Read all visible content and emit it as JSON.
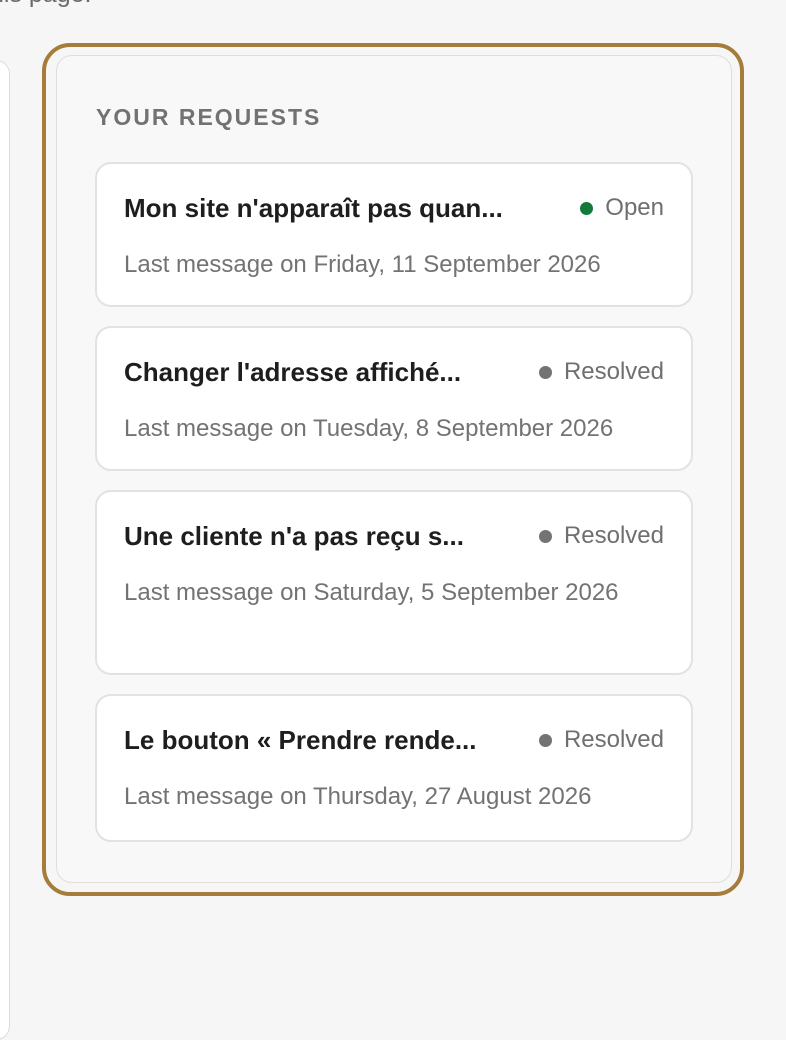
{
  "page": {
    "top_text": "his page."
  },
  "requests": {
    "title": "YOUR REQUESTS",
    "items": [
      {
        "title": "Mon site n'apparaît pas quan...",
        "status": "Open",
        "status_color": "#137a3b",
        "last_message": "Last message on Friday, 11 September 2026"
      },
      {
        "title": "Changer l'adresse affiché...",
        "status": "Resolved",
        "status_color": "#737373",
        "last_message": "Last message on Tuesday, 8 September 2026"
      },
      {
        "title": "Une cliente n'a pas reçu s...",
        "status": "Resolved",
        "status_color": "#737373",
        "last_message": "Last message on Saturday, 5 September 2026"
      },
      {
        "title": "Le bouton « Prendre rende...",
        "status": "Resolved",
        "status_color": "#737373",
        "last_message": "Last message on Thursday, 27 August 2026"
      }
    ]
  },
  "theme": {
    "highlight_color": "#a57c3a",
    "background": "#f6f6f6",
    "card_background": "#ffffff"
  }
}
